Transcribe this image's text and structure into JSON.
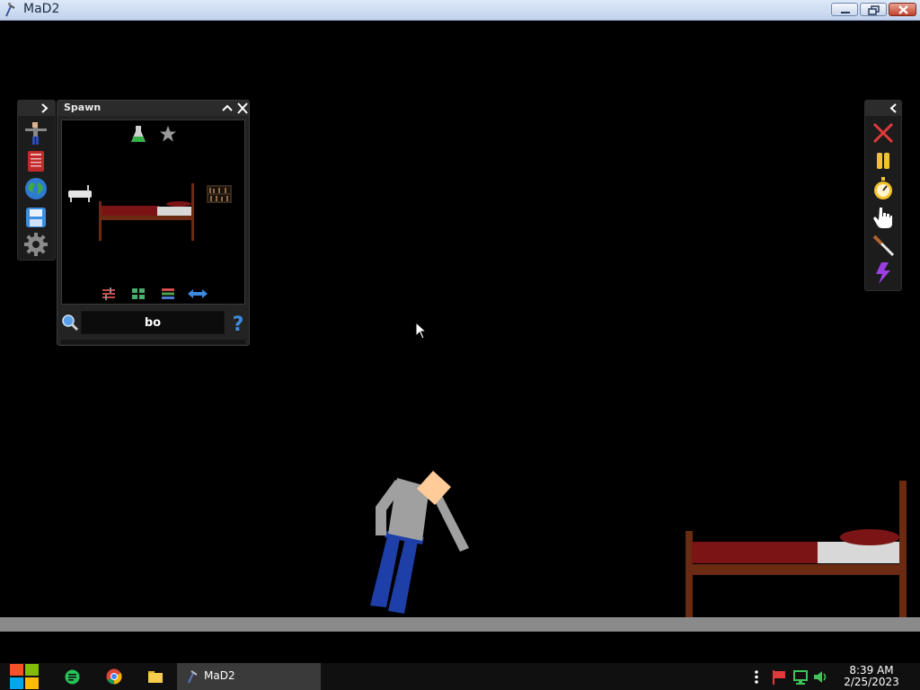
{
  "window": {
    "title": "MaD2",
    "buttons": [
      "minimize",
      "restore",
      "close"
    ]
  },
  "left_toolbar": {
    "items": [
      {
        "icon": "ragdoll-icon"
      },
      {
        "icon": "book-icon"
      },
      {
        "icon": "globe-icon"
      },
      {
        "icon": "save-icon"
      },
      {
        "icon": "gear-icon"
      }
    ]
  },
  "spawn_panel": {
    "title": "Spawn",
    "top_icons": [
      "flask-icon",
      "star-icon"
    ],
    "items": [
      "bathtub",
      "bed",
      "bookshelf"
    ],
    "bottom_icons": [
      "filter-icon",
      "grid-view-icon",
      "list-view-icon",
      "swap-arrows-icon"
    ],
    "search": {
      "value": "bo"
    }
  },
  "right_toolbar": {
    "items": [
      {
        "icon": "delete-x-icon"
      },
      {
        "icon": "pause-icon"
      },
      {
        "icon": "stopwatch-icon"
      },
      {
        "icon": "hand-icon"
      },
      {
        "icon": "knife-icon"
      },
      {
        "icon": "lightning-icon"
      }
    ]
  },
  "taskbar": {
    "apps": [
      "windows-start-icon",
      "chat-app-icon",
      "chrome-icon",
      "folder-icon"
    ],
    "active_task": "MaD2",
    "clock": {
      "time": "8:39 AM",
      "date": "2/25/2023"
    }
  },
  "colors": {
    "background": "#000000",
    "floor": "#8a8a8a",
    "bed_frame": "#6b2a12",
    "bed_blanket": "#7b1515",
    "ragdoll_shirt": "#a0a0a0",
    "ragdoll_pants": "#1f3fa8",
    "ragdoll_head": "#ffcc99"
  }
}
